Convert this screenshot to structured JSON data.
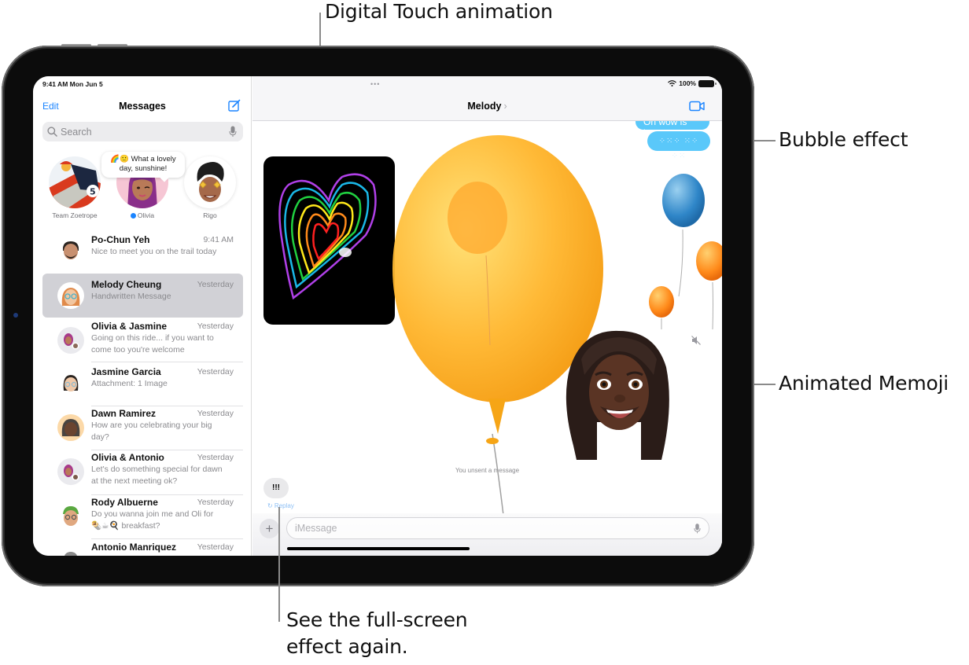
{
  "callouts": {
    "digital_touch": "Digital Touch animation",
    "bubble_effect": "Bubble effect",
    "animated_memoji": "Animated Memoji",
    "replay_line1": "See the full-screen",
    "replay_line2": "effect again."
  },
  "status_bar": {
    "time_date": "9:41 AM   Mon Jun 5",
    "battery": "100%",
    "more_dots": "•••"
  },
  "sidebar": {
    "edit_label": "Edit",
    "title": "Messages",
    "search_placeholder": "Search",
    "pinned": [
      {
        "name": "Team Zoetrope"
      },
      {
        "name": "Olivia",
        "unread": true,
        "tip_line1": "🌈🙂 What a lovely",
        "tip_line2": "day, sunshine!"
      },
      {
        "name": "Rigo"
      }
    ],
    "conversations": [
      {
        "name": "Po-Chun Yeh",
        "time": "9:41 AM",
        "preview": "Nice to meet you on the trail today",
        "selected": false
      },
      {
        "name": "Melody Cheung",
        "time": "Yesterday",
        "preview": "Handwritten Message",
        "selected": true
      },
      {
        "name": "Olivia & Jasmine",
        "time": "Yesterday",
        "preview": "Going on this ride... if you want to come too you're welcome",
        "selected": false
      },
      {
        "name": "Jasmine Garcia",
        "time": "Yesterday",
        "preview": "Attachment: 1 Image",
        "selected": false
      },
      {
        "name": "Dawn Ramirez",
        "time": "Yesterday",
        "preview": "How are you celebrating your big day?",
        "selected": false
      },
      {
        "name": "Olivia & Antonio",
        "time": "Yesterday",
        "preview": "Let's do something special for dawn at the next meeting ok?",
        "selected": false
      },
      {
        "name": "Rody Albuerne",
        "time": "Yesterday",
        "preview": "Do you wanna join me and Oli for 🌯☕🍳 breakfast?",
        "selected": false
      },
      {
        "name": "Antonio Manriquez",
        "time": "Yesterday",
        "preview": "",
        "selected": false
      }
    ]
  },
  "conversation": {
    "contact_name": "Melody",
    "chevron": "›",
    "messages": {
      "outgoing_1": "Oh wow is it...",
      "outgoing_2_invisible_ink": "⁘⁙⁘ ⁙⁘ ⁘⁙",
      "unsent_notice": "You unsent a message",
      "incoming_bang": "!!!",
      "replay_label": "↻ Replay"
    },
    "input_placeholder": "iMessage",
    "plus_label": "+"
  },
  "colors": {
    "accent_blue": "#1a84ff",
    "bubble_blue": "#5ac8fa",
    "selected_row": "#d1d1d6",
    "balloon_yellow": "#ffb31a",
    "balloon_orange": "#ff8a1a",
    "balloon_blue": "#2f86c8"
  }
}
